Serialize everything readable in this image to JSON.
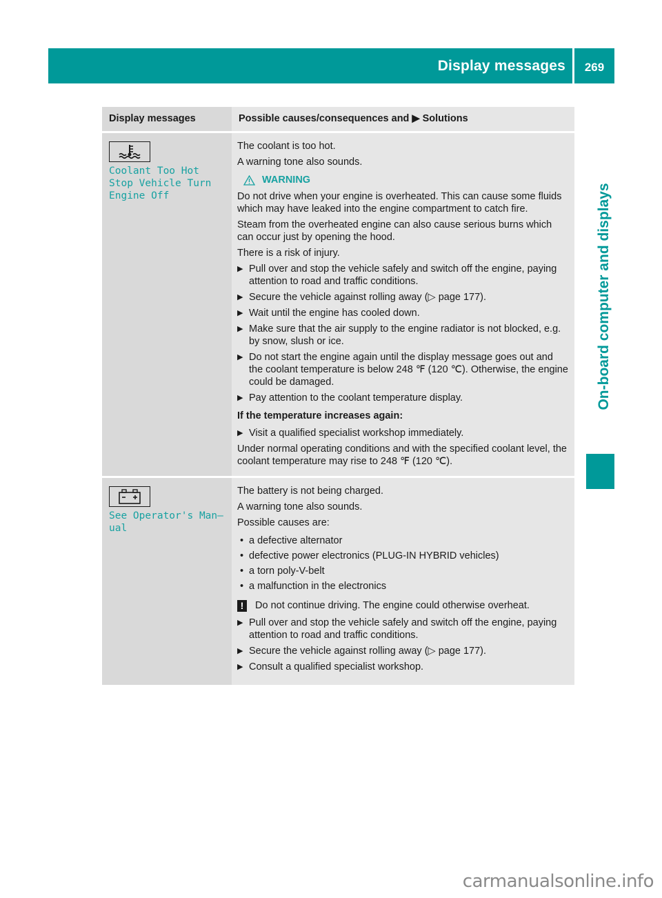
{
  "header": {
    "section_title": "Display messages",
    "page_number": "269"
  },
  "side_tab": {
    "label": "On-board computer and displays"
  },
  "table": {
    "columns": [
      "Display messages",
      "Possible causes/consequences and ▶ Solutions"
    ],
    "rows": [
      {
        "icon": "coolant-temperature-icon",
        "message_lines": [
          "Coolant Too Hot",
          "Stop Vehicle Turn",
          "Engine Off"
        ],
        "intro": [
          "The coolant is too hot.",
          "A warning tone also sounds."
        ],
        "warning_label": "WARNING",
        "warning_text": [
          "Do not drive when your engine is overheated. This can cause some fluids which may have leaked into the engine compartment to catch fire.",
          "Steam from the overheated engine can also cause serious burns which can occur just by opening the hood.",
          "There is a risk of injury."
        ],
        "steps": [
          "Pull over and stop the vehicle safely and switch off the engine, paying attention to road and traffic conditions.",
          "Secure the vehicle against rolling away (▷ page 177).",
          "Wait until the engine has cooled down.",
          "Make sure that the air supply to the engine radiator is not blocked, e.g. by snow, slush or ice.",
          "Do not start the engine again until the display message goes out and the coolant temperature is below 248 ℉ (120 ℃). Otherwise, the engine could be damaged.",
          "Pay attention to the coolant temperature display."
        ],
        "subheading": "If the temperature increases again:",
        "sub_steps": [
          "Visit a qualified specialist workshop immediately."
        ],
        "footer": "Under normal operating conditions and with the specified coolant level, the coolant temperature may rise to 248 ℉ (120 ℃)."
      },
      {
        "icon": "battery-icon",
        "message_lines": [
          "See Operator's Man–",
          "ual"
        ],
        "intro": [
          "The battery is not being charged.",
          "A warning tone also sounds.",
          "Possible causes are:"
        ],
        "causes": [
          "a defective alternator",
          "defective power electronics (PLUG-IN HYBRID vehicles)",
          "a torn poly-V-belt",
          "a malfunction in the electronics"
        ],
        "notice": "Do not continue driving. The engine could otherwise overheat.",
        "steps": [
          "Pull over and stop the vehicle safely and switch off the engine, paying attention to road and traffic conditions.",
          "Secure the vehicle against rolling away (▷ page 177).",
          "Consult a qualified specialist workshop."
        ]
      }
    ]
  },
  "watermark": "carmanualsonline.info",
  "colors": {
    "accent": "#009999",
    "mono_text": "#17a1a1",
    "cell_dark": "#d9d9d9",
    "cell_light": "#e6e6e6"
  }
}
